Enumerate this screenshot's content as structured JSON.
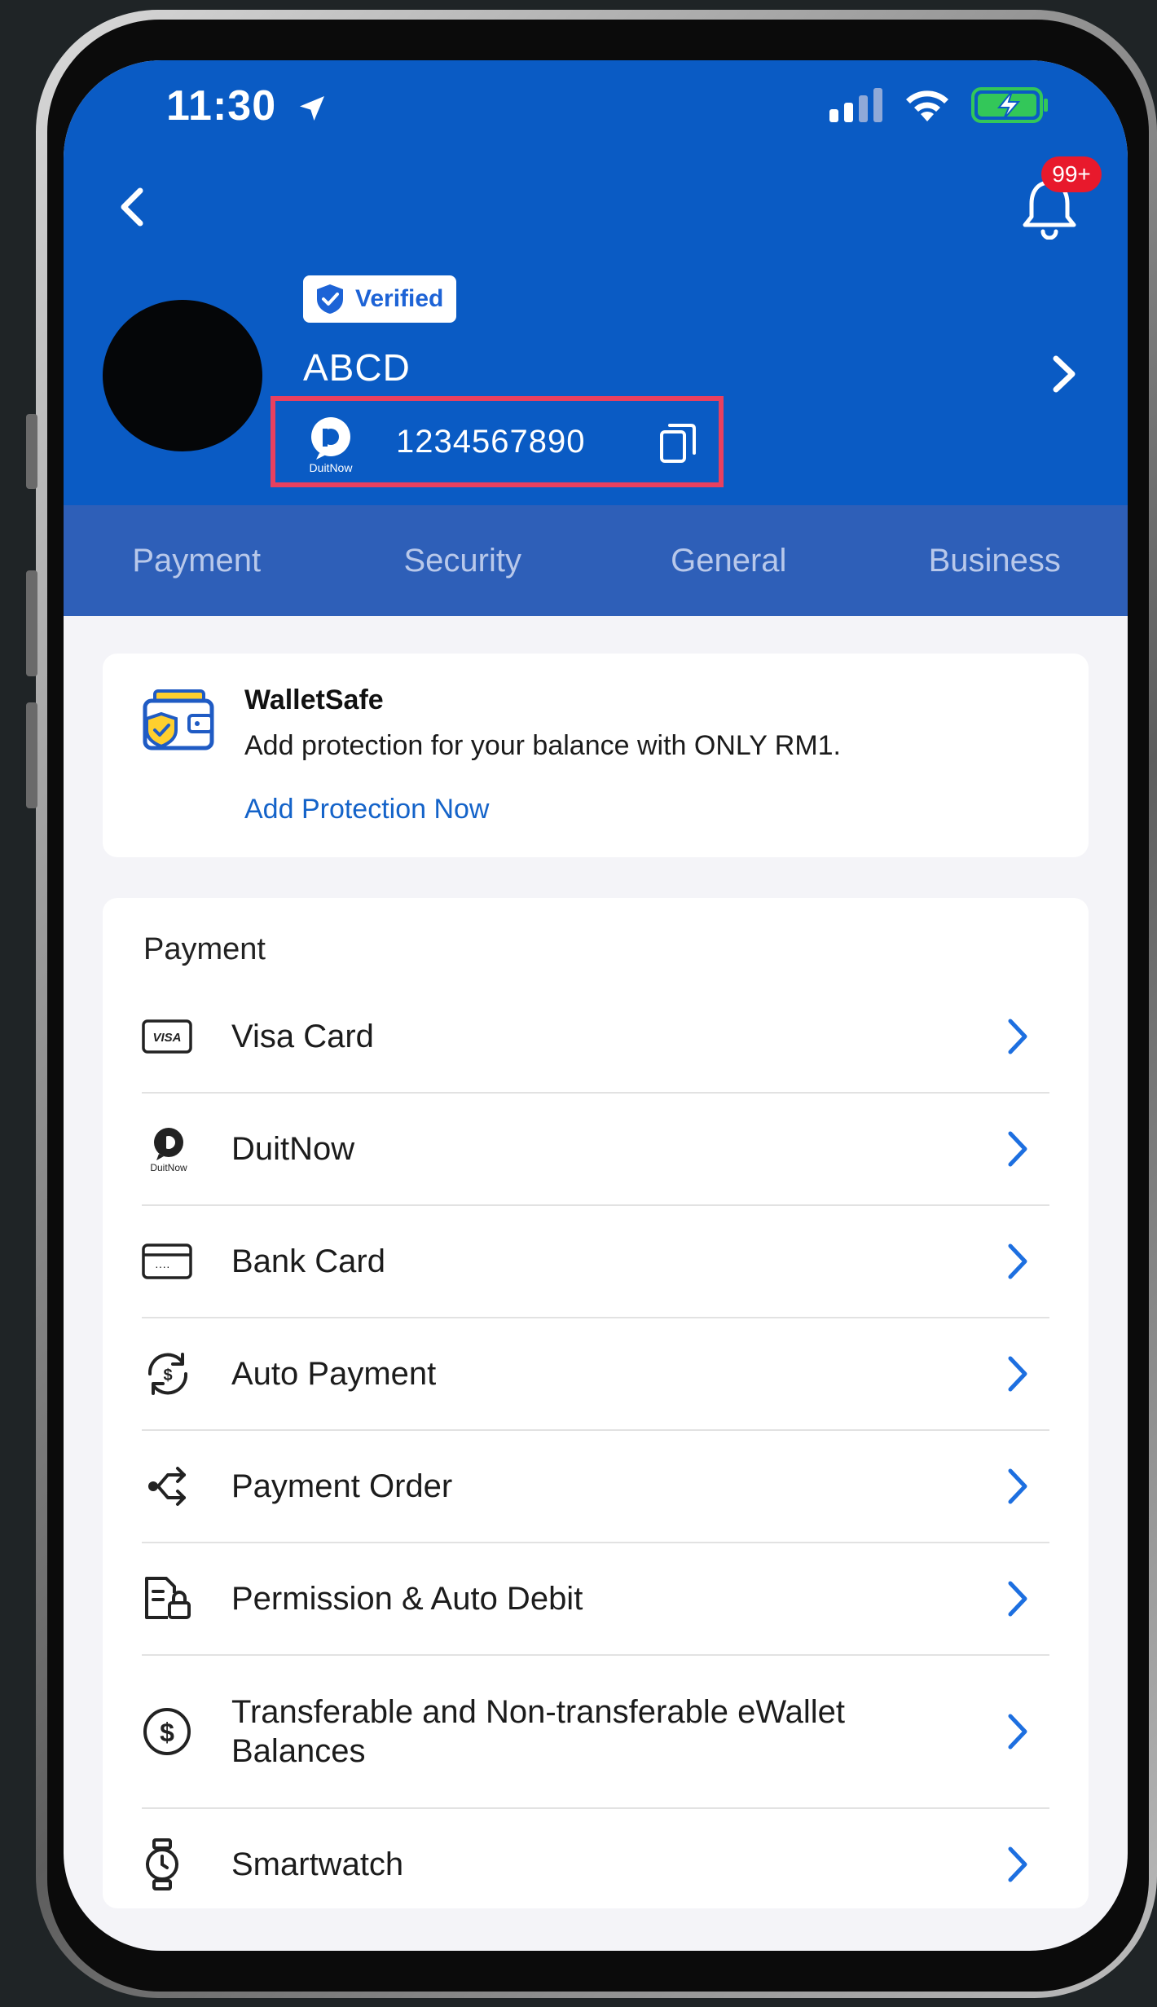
{
  "status_bar": {
    "time": "11:30"
  },
  "header": {
    "notification_count": "99+",
    "verified_label": "Verified",
    "username": "ABCD",
    "duitnow_logo_text": "DuitNow",
    "duitnow_id": "1234567890"
  },
  "tabs": [
    {
      "label": "Payment"
    },
    {
      "label": "Security"
    },
    {
      "label": "General"
    },
    {
      "label": "Business"
    }
  ],
  "walletsafe": {
    "title": "WalletSafe",
    "description": "Add protection for your balance with ONLY RM1.",
    "link": "Add Protection Now"
  },
  "payment_section": {
    "title": "Payment",
    "items": [
      {
        "label": "Visa Card",
        "icon": "visa-icon",
        "icon_text": "VISA"
      },
      {
        "label": "DuitNow",
        "icon": "duitnow-icon",
        "icon_text": "DuitNow"
      },
      {
        "label": "Bank Card",
        "icon": "bank-card-icon"
      },
      {
        "label": "Auto Payment",
        "icon": "auto-payment-icon"
      },
      {
        "label": "Payment Order",
        "icon": "payment-order-icon"
      },
      {
        "label": "Permission & Auto Debit",
        "icon": "permission-icon"
      },
      {
        "label": "Transferable and Non-transferable eWallet Balances",
        "icon": "dollar-circle-icon"
      },
      {
        "label": "Smartwatch",
        "icon": "smartwatch-icon"
      }
    ]
  },
  "colors": {
    "header_blue": "#0a5bc4",
    "tab_bar_blue": "#2e5fb8",
    "link_blue": "#1463c9",
    "highlight_red": "#e8405f",
    "badge_red": "#e8192c",
    "battery_green": "#33c759"
  }
}
